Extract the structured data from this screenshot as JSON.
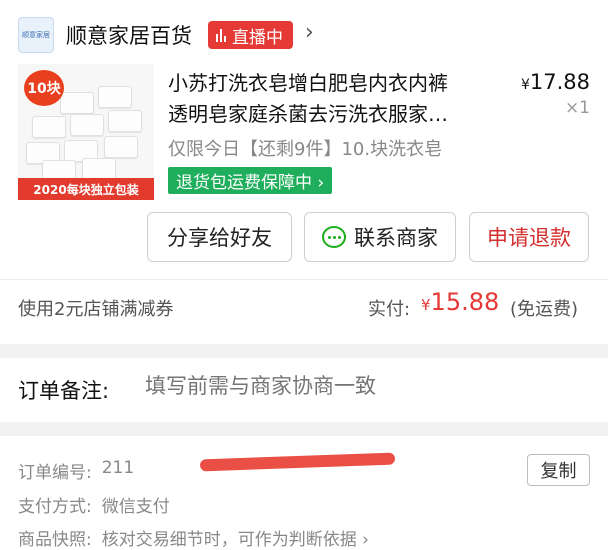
{
  "shop": {
    "logo_text": "顺意家居",
    "name": "顺意家居百货",
    "live_badge": "直播中",
    "chevron": "›"
  },
  "product": {
    "title_line1": "小苏打洗衣皂增白肥皂内衣内裤",
    "title_line2": "透明皂家庭杀菌去污洗衣服家…",
    "price_currency": "¥",
    "price": "17.88",
    "quantity": "×1",
    "spec": "仅限今日【还剩9件】10.块洗衣皂",
    "guarantee": "退货包运费保障中 ›",
    "thumb_tag": "10块",
    "thumb_banner": "2020每块独立包装"
  },
  "actions": {
    "share": "分享给好友",
    "contact": "联系商家",
    "refund": "申请退款"
  },
  "summary": {
    "coupon": "使用2元店铺满减券",
    "paid_label": "实付:",
    "paid_currency": "¥",
    "paid_amount": "15.88",
    "freight": "(免运费)"
  },
  "remark": {
    "label": "订单备注:",
    "placeholder": "填写前需与商家协商一致"
  },
  "info": {
    "order_label": "订单编号:",
    "order_value": "211",
    "copy_label": "复制",
    "pay_label": "支付方式:",
    "pay_value": "微信支付",
    "snapshot_label": "商品快照:",
    "snapshot_value": "核对交易细节时，可作为判断依据 ›"
  },
  "colors": {
    "accent_red": "#e53935",
    "guarantee_green": "#1fae5b",
    "wechat_green": "#1aad19"
  },
  "icons": {
    "live": "live-bars-icon",
    "contact": "wechat-chat-icon",
    "shop": "shop-logo-icon"
  }
}
